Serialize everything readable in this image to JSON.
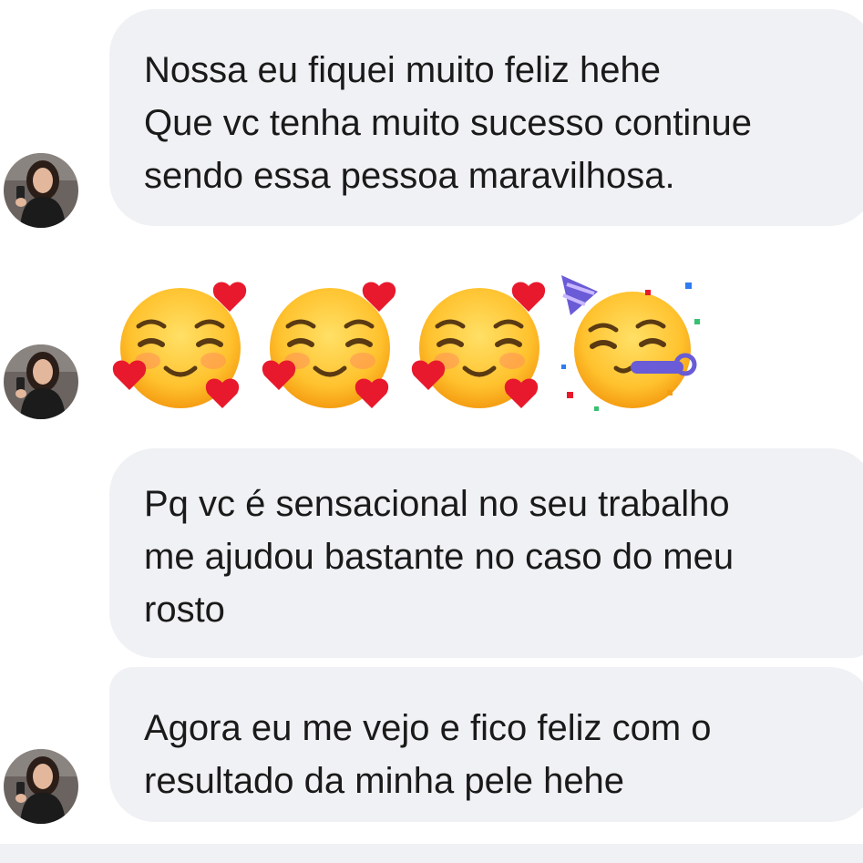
{
  "conversation": {
    "messages": [
      {
        "lines": [
          "Nossa eu fiquei muito feliz hehe",
          "Que vc tenha muito sucesso continue",
          "sendo essa pessoa maravilhosa."
        ]
      },
      {
        "emojis": [
          "smiling-face-with-hearts",
          "smiling-face-with-hearts",
          "smiling-face-with-hearts",
          "partying-face"
        ]
      },
      {
        "lines": [
          "Pq vc é sensacional no seu trabalho",
          "me ajudou bastante no caso do meu",
          "rosto"
        ]
      },
      {
        "lines": [
          "Agora eu me vejo e fico feliz com o",
          "resultado da minha pele hehe"
        ]
      }
    ]
  },
  "colors": {
    "bubble_background": "#f0f1f4",
    "text": "#1a1a1a",
    "background": "#ffffff"
  }
}
